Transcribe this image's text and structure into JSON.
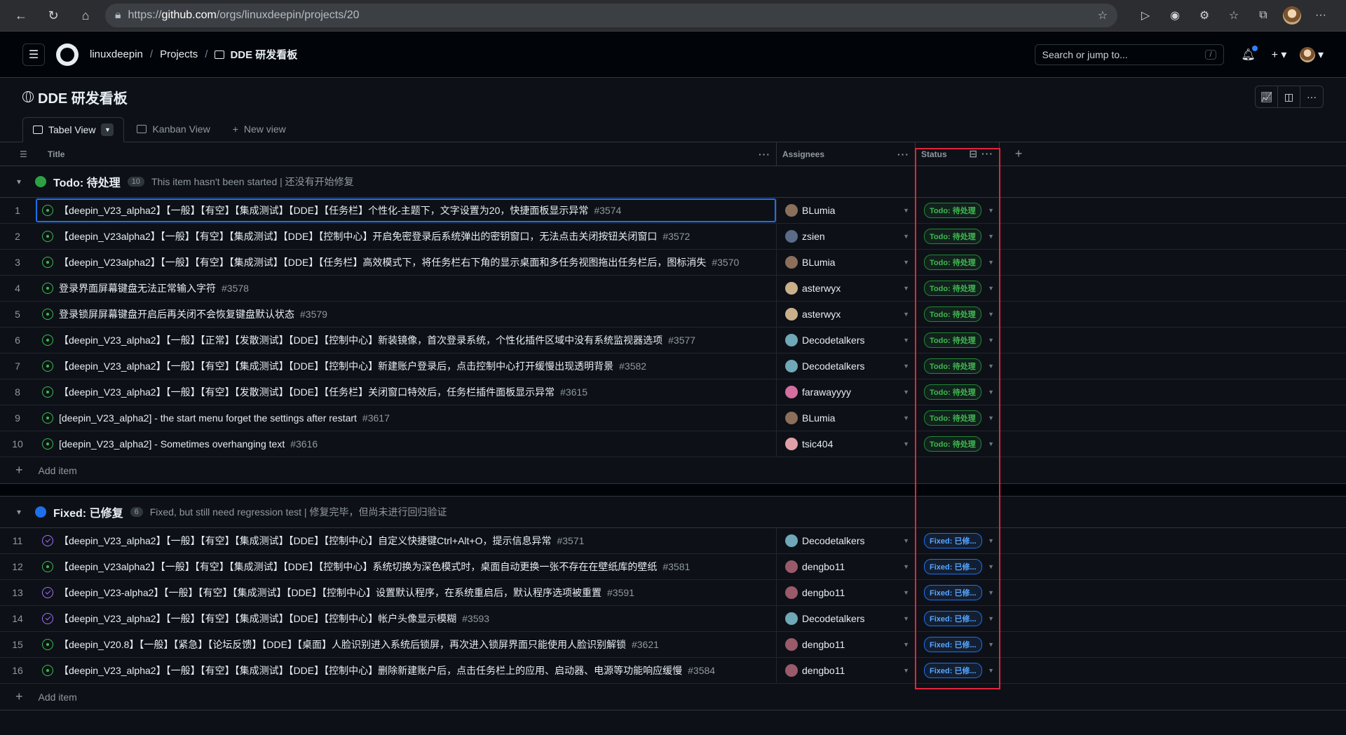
{
  "browser": {
    "url_prefix": "https://",
    "url_host": "github.com",
    "url_path": "/orgs/linuxdeepin/projects/20"
  },
  "header": {
    "org": "linuxdeepin",
    "projects": "Projects",
    "project_name": "DDE 研发看板",
    "search_placeholder": "Search or jump to...",
    "search_kbd": "/"
  },
  "project": {
    "title": "DDE 研发看板"
  },
  "tabs": [
    {
      "label": "Tabel View"
    },
    {
      "label": "Kanban View"
    },
    {
      "label": "New view"
    }
  ],
  "columns": {
    "title": "Title",
    "assignees": "Assignees",
    "status": "Status"
  },
  "groups": [
    {
      "name": "Todo: 待处理",
      "count": "10",
      "description": "This item hasn't been started | 还没有开始修复",
      "color": "#2ea043",
      "add_item": "Add item",
      "rows": [
        {
          "num": "1",
          "title": "【deepin_V23_alpha2】【一般】【有空】【集成测试】【DDE】【任务栏】个性化-主题下，文字设置为20，快捷面板显示异常",
          "issue": "#3574",
          "assignee": "BLumia",
          "status": "Todo: 待处理",
          "done": false
        },
        {
          "num": "2",
          "title": "【deepin_V23alpha2】【一般】【有空】【集成测试】【DDE】【控制中心】开启免密登录后系统弹出的密钥窗口，无法点击关闭按钮关闭窗口",
          "issue": "#3572",
          "assignee": "zsien",
          "status": "Todo: 待处理",
          "done": false
        },
        {
          "num": "3",
          "title": "【deepin_V23alpha2】【一般】【有空】【集成测试】【DDE】【任务栏】高效模式下，将任务栏右下角的显示桌面和多任务视图拖出任务栏后，图标消失",
          "issue": "#3570",
          "assignee": "BLumia",
          "status": "Todo: 待处理",
          "done": false
        },
        {
          "num": "4",
          "title": "登录界面屏幕键盘无法正常输入字符",
          "issue": "#3578",
          "assignee": "asterwyx",
          "status": "Todo: 待处理",
          "done": false
        },
        {
          "num": "5",
          "title": "登录锁屏屏幕键盘开启后再关闭不会恢复键盘默认状态",
          "issue": "#3579",
          "assignee": "asterwyx",
          "status": "Todo: 待处理",
          "done": false
        },
        {
          "num": "6",
          "title": "【deepin_V23_alpha2】【一般】【正常】【发散测试】【DDE】【控制中心】新装镜像，首次登录系统，个性化插件区域中没有系统监视器选项",
          "issue": "#3577",
          "assignee": "Decodetalkers",
          "status": "Todo: 待处理",
          "done": false
        },
        {
          "num": "7",
          "title": "【deepin_V23_alpha2】【一般】【有空】【集成测试】【DDE】【控制中心】新建账户登录后，点击控制中心打开缓慢出现透明背景",
          "issue": "#3582",
          "assignee": "Decodetalkers",
          "status": "Todo: 待处理",
          "done": false
        },
        {
          "num": "8",
          "title": "【deepin_V23_alpha2】【一般】【有空】【发散测试】【DDE】【任务栏】关闭窗口特效后，任务栏插件面板显示异常",
          "issue": "#3615",
          "assignee": "farawayyyy",
          "status": "Todo: 待处理",
          "done": false
        },
        {
          "num": "9",
          "title": "[deepin_V23_alpha2] - the start menu forget the settings after restart",
          "issue": "#3617",
          "assignee": "BLumia",
          "status": "Todo: 待处理",
          "done": false
        },
        {
          "num": "10",
          "title": "[deepin_V23_alpha2] - Sometimes overhanging text",
          "issue": "#3616",
          "assignee": "tsic404",
          "status": "Todo: 待处理",
          "done": false
        }
      ]
    },
    {
      "name": "Fixed: 已修复",
      "count": "6",
      "description": "Fixed, but still need regression test | 修复完毕，但尚未进行回归验证",
      "color": "#1f6feb",
      "add_item": "Add item",
      "rows": [
        {
          "num": "11",
          "title": "【deepin_V23_alpha2】【一般】【有空】【集成测试】【DDE】【控制中心】自定义快捷键Ctrl+Alt+O，提示信息异常",
          "issue": "#3571",
          "assignee": "Decodetalkers",
          "status": "Fixed: 已修...",
          "done": true
        },
        {
          "num": "12",
          "title": "【deepin_V23alpha2】【一般】【有空】【集成测试】【DDE】【控制中心】系统切换为深色模式时，桌面自动更换一张不存在在壁纸库的壁纸",
          "issue": "#3581",
          "assignee": "dengbo11",
          "status": "Fixed: 已修...",
          "done": false
        },
        {
          "num": "13",
          "title": "【deepin_V23-alpha2】【一般】【有空】【集成测试】【DDE】【控制中心】设置默认程序，在系统重启后，默认程序选项被重置",
          "issue": "#3591",
          "assignee": "dengbo11",
          "status": "Fixed: 已修...",
          "done": true
        },
        {
          "num": "14",
          "title": "【deepin_V23_alpha2】【一般】【有空】【集成测试】【DDE】【控制中心】帐户头像显示模糊",
          "issue": "#3593",
          "assignee": "Decodetalkers",
          "status": "Fixed: 已修...",
          "done": true
        },
        {
          "num": "15",
          "title": "【deepin_V20.8】【一般】【紧急】【论坛反馈】【DDE】【桌面】人脸识别进入系统后锁屏，再次进入锁屏界面只能使用人脸识别解锁",
          "issue": "#3621",
          "assignee": "dengbo11",
          "status": "Fixed: 已修...",
          "done": false
        },
        {
          "num": "16",
          "title": "【deepin_V23_alpha2】【一般】【有空】【集成测试】【DDE】【控制中心】删除新建账户后，点击任务栏上的应用、启动器、电源等功能响应缓慢",
          "issue": "#3584",
          "assignee": "dengbo11",
          "status": "Fixed: 已修...",
          "done": false
        }
      ]
    }
  ],
  "avatar_colors": {
    "BLumia": "#8b6f5a",
    "zsien": "#5b6b8a",
    "asterwyx": "#c9b08a",
    "Decodetalkers": "#6fa8b8",
    "farawayyyy": "#d56fa0",
    "tsic404": "#e0a0a8",
    "dengbo11": "#9a5a6a"
  }
}
